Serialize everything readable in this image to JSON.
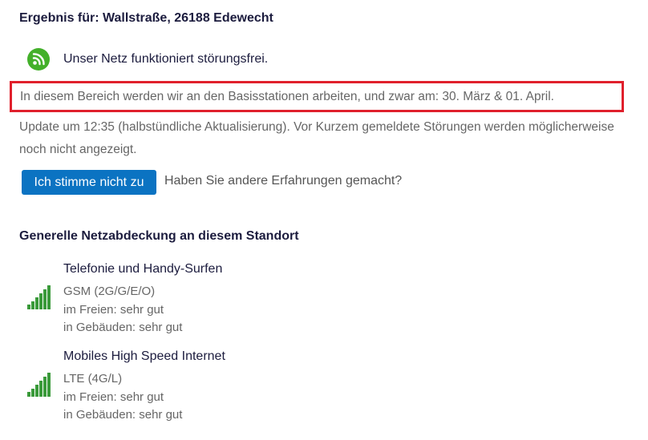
{
  "result": {
    "heading": "Ergebnis für: Wallstraße, 26188 Edewecht"
  },
  "status": {
    "icon": "wifi-signal-icon",
    "icon_color": "#43b02a",
    "text": "Unser Netz funktioniert störungsfrei."
  },
  "notice": {
    "text": "In diesem Bereich werden wir an den Basisstationen arbeiten, und zwar am: 30. März & 01. April.",
    "border_color": "#e0202c"
  },
  "update": {
    "text": "Update um 12:35 (halbstündliche Aktualisierung). Vor Kurzem gemeldete Störungen werden möglicherweise noch nicht angezeigt."
  },
  "feedback": {
    "button_label": "Ich stimme nicht zu",
    "button_color": "#0b73c2",
    "question": "Haben Sie andere Erfahrungen gemacht?"
  },
  "coverage": {
    "heading": "Generelle Netzabdeckung an diesem Standort",
    "items": [
      {
        "icon": "signal-bars-icon",
        "title": "Telefonie und Handy-Surfen",
        "technology": "GSM (2G/G/E/O)",
        "outdoor": "im Freien: sehr gut",
        "indoor": "in Gebäuden: sehr gut"
      },
      {
        "icon": "signal-bars-icon",
        "title": "Mobiles High Speed Internet",
        "technology": "LTE (4G/L)",
        "outdoor": "im Freien: sehr gut",
        "indoor": "in Gebäuden: sehr gut"
      }
    ]
  }
}
